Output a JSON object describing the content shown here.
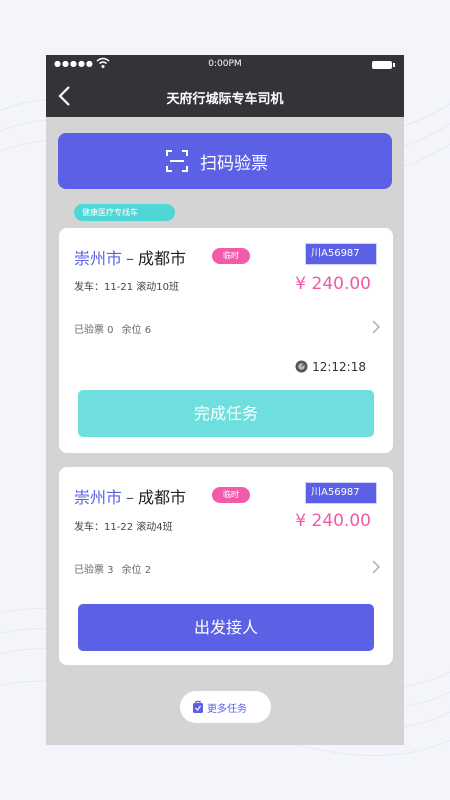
{
  "status_bar": {
    "signal": "●●●●●",
    "time": "0:00PM"
  },
  "header": {
    "title": "天府行城际专车司机"
  },
  "scan_button": {
    "label": "扫码验票"
  },
  "service_tag": "健康医疗专线车",
  "tasks": [
    {
      "from": "崇州市",
      "dash": "–",
      "to": "成都市",
      "badge": "临时",
      "plate": "川A56987",
      "departure": "发车：11-21 滚动10班",
      "price": "¥ 240.00",
      "checked": "已验票 0",
      "seats": "余位 6",
      "countdown": "12:12:18",
      "action_label": "完成任务"
    },
    {
      "from": "崇州市",
      "dash": "–",
      "to": "成都市",
      "badge": "临时",
      "plate": "川A56987",
      "departure": "发车：11-22 滚动4班",
      "price": "¥ 240.00",
      "checked": "已验票 3",
      "seats": "余位 2",
      "action_label": "出发接人"
    }
  ],
  "more_button": {
    "label": "更多任务"
  },
  "colors": {
    "primary": "#5c60e4",
    "cyan": "#6fdede",
    "pink": "#f25ba8",
    "navbar": "#323438"
  }
}
